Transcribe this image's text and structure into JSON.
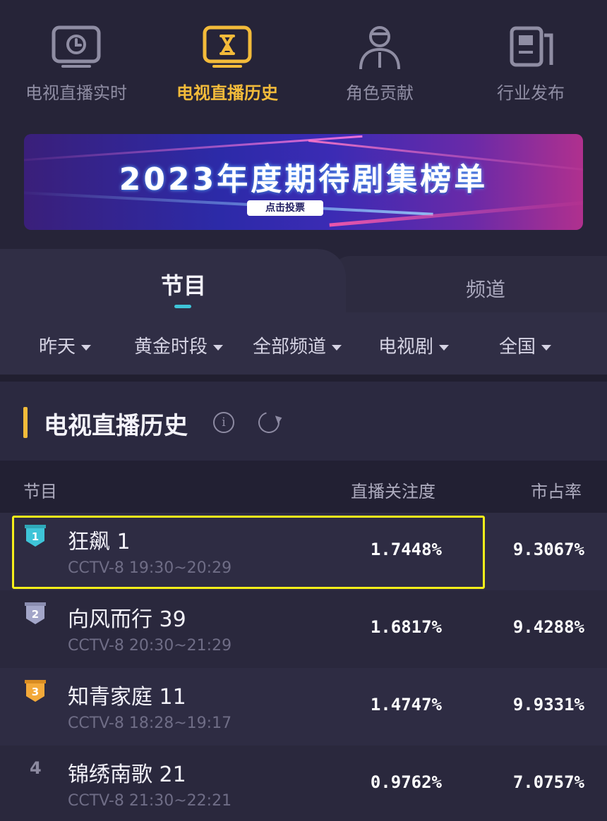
{
  "nav": {
    "items": [
      {
        "label": "电视直播实时",
        "icon": "tv-clock-icon",
        "active": false
      },
      {
        "label": "电视直播历史",
        "icon": "tv-hourglass-icon",
        "active": true
      },
      {
        "label": "角色贡献",
        "icon": "person-icon",
        "active": false
      },
      {
        "label": "行业发布",
        "icon": "report-icon",
        "active": false
      }
    ]
  },
  "banner": {
    "title": "2023年度期待剧集榜单",
    "button": "点击投票"
  },
  "tabs": [
    "节目",
    "频道"
  ],
  "filters": [
    "昨天",
    "黄金时段",
    "全部频道",
    "电视剧",
    "全国"
  ],
  "section": {
    "title": "电视直播历史"
  },
  "table": {
    "headers": [
      "节目",
      "直播关注度",
      "市占率"
    ],
    "rows": [
      {
        "rank": "1",
        "name": "狂飙 1",
        "sub": "CCTV-8 19:30~20:29",
        "attention": "1.7448%",
        "share": "9.3067%"
      },
      {
        "rank": "2",
        "name": "向风而行 39",
        "sub": "CCTV-8 20:30~21:29",
        "attention": "1.6817%",
        "share": "9.4288%"
      },
      {
        "rank": "3",
        "name": "知青家庭 11",
        "sub": "CCTV-8 18:28~19:17",
        "attention": "1.4747%",
        "share": "9.9331%"
      },
      {
        "rank": "4",
        "name": "锦绣南歌 21",
        "sub": "CCTV-8 21:30~22:21",
        "attention": "0.9762%",
        "share": "7.0757%"
      }
    ]
  },
  "colors": {
    "accent": "#f3bb3a",
    "tab_underline": "#3ec4d8",
    "highlight_box": "#f5ef1a",
    "rank1": "#3ec4d8",
    "rank2": "#a3a6c9",
    "rank3": "#f3a93a"
  }
}
